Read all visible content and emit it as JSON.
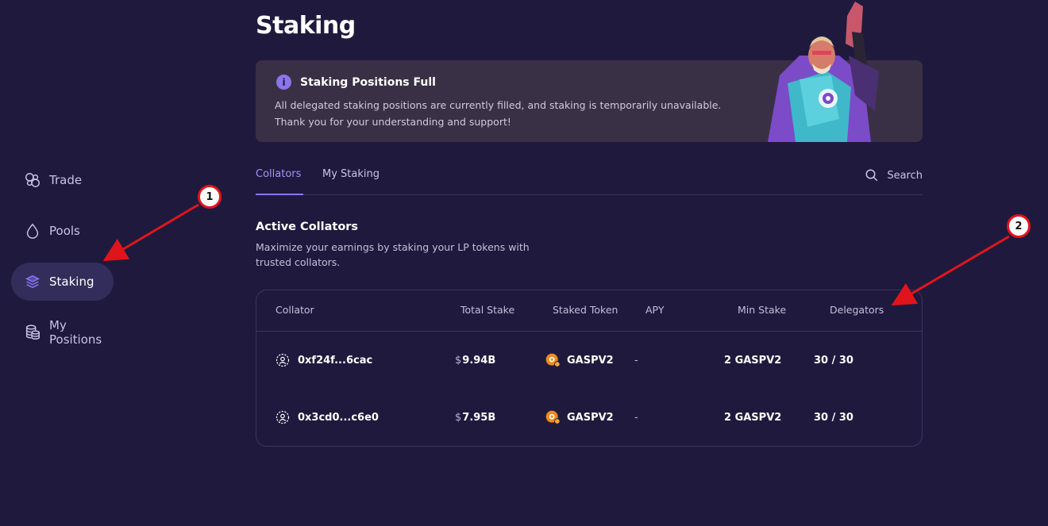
{
  "page": {
    "title": "Staking"
  },
  "sidebar": {
    "items": [
      {
        "label": "Trade",
        "icon": "trade-icon",
        "active": false
      },
      {
        "label": "Pools",
        "icon": "droplet-icon",
        "active": false
      },
      {
        "label": "Staking",
        "icon": "layers-icon",
        "active": true
      },
      {
        "label": "My Positions",
        "icon": "coins-icon",
        "active": false
      }
    ]
  },
  "banner": {
    "title": "Staking Positions Full",
    "line1": "All delegated staking positions are currently filled, and staking is temporarily unavailable.",
    "line2": "Thank you for your understanding and support!"
  },
  "tabs": {
    "items": [
      "Collators",
      "My Staking"
    ],
    "active": "Collators",
    "search_label": "Search"
  },
  "section": {
    "title": "Active Collators",
    "description": "Maximize your earnings by staking your LP tokens with trusted collators."
  },
  "table": {
    "headers": [
      "Collator",
      "Total Stake",
      "Staked Token",
      "APY",
      "Min Stake",
      "Delegators"
    ],
    "rows": [
      {
        "collator": "0xf24f...6cac",
        "currency": "$",
        "total_stake": "9.94B",
        "token": "GASPV2",
        "apy": "-",
        "min_stake": "2 GASPV2",
        "delegators": "30 / 30"
      },
      {
        "collator": "0x3cd0...c6e0",
        "currency": "$",
        "total_stake": "7.95B",
        "token": "GASPV2",
        "apy": "-",
        "min_stake": "2 GASPV2",
        "delegators": "30 / 30"
      }
    ]
  },
  "annotations": [
    {
      "number": "1"
    },
    {
      "number": "2"
    }
  ],
  "colors": {
    "background": "#1f1a3d",
    "accent": "#8a77f0",
    "banner": "#3a3045",
    "annotation": "#e0151b",
    "token": "#f08a1c"
  }
}
